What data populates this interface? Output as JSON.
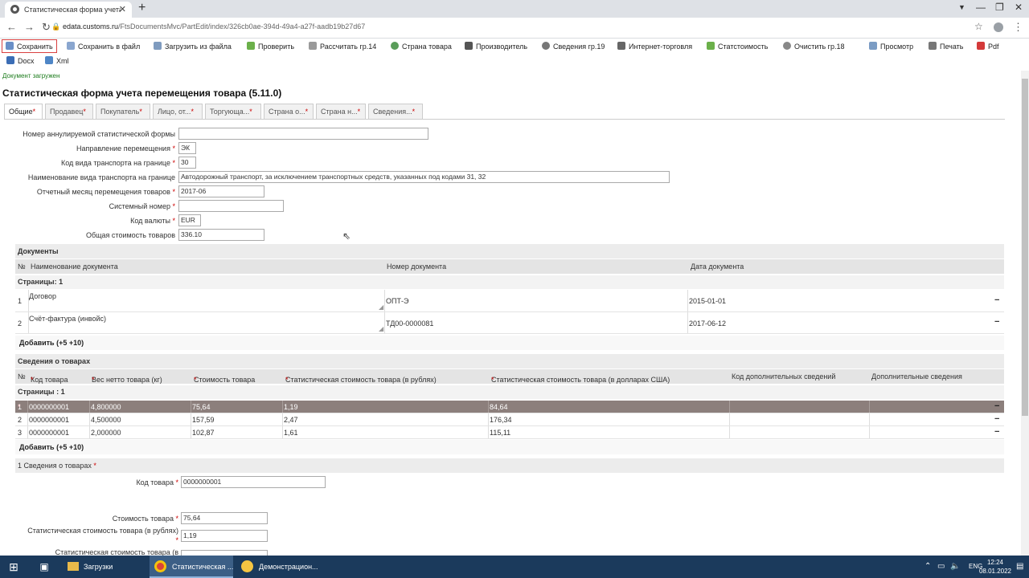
{
  "browser": {
    "tab_title": "Статистическая форма учета п...",
    "tab_close": "✕",
    "new_tab": "+",
    "url_host": "edata.customs.ru",
    "url_path": "/FtsDocumentsMvc/PartEdit/index/326cb0ae-394d-49a4-a27f-aadb19b27d67"
  },
  "toolbar": {
    "save": "Сохранить",
    "save_file": "Сохранить в файл",
    "load_file": "Загрузить из файла",
    "check": "Проверить",
    "calc": "Рассчитать гр.14",
    "country": "Страна товара",
    "producer": "Производитель",
    "info19": "Сведения гр.19",
    "internet": "Интернет-торговля",
    "statcost": "Статстоимость",
    "clear18": "Очистить гр.18",
    "preview": "Просмотр",
    "print": "Печать",
    "pdf": "Pdf",
    "docx": "Docx",
    "xml": "Xml"
  },
  "status": "Документ загружен",
  "page_title": "Статистическая форма учета перемещения товара (5.11.0)",
  "tabs": [
    {
      "label": "Общие"
    },
    {
      "label": "Продавец"
    },
    {
      "label": "Покупатель"
    },
    {
      "label": "Лицо, от..."
    },
    {
      "label": "Торгующа..."
    },
    {
      "label": "Страна о..."
    },
    {
      "label": "Страна н..."
    },
    {
      "label": "Сведения..."
    }
  ],
  "required_mark": "*",
  "form": {
    "annul_label": "Номер аннулируемой статистической формы",
    "annul_value": "",
    "direction_label": "Направление перемещения",
    "direction_value": "ЭК",
    "transport_code_label": "Код вида транспорта на границе",
    "transport_code_value": "30",
    "transport_name_label": "Наименование вида транспорта на границе",
    "transport_name_value": "Автодорожный транспорт, за исключением транспортных средств, указанных под кодами 31, 32",
    "month_label": "Отчетный месяц перемещения товаров",
    "month_value": "2017-06",
    "sysnum_label": "Системный номер",
    "sysnum_value": "",
    "currency_label": "Код валюты",
    "currency_value": "EUR",
    "total_label": "Общая стоимость товаров",
    "total_value": "336.10"
  },
  "documents": {
    "title": "Документы",
    "columns": [
      "№",
      "Наименование документа",
      "Номер документа",
      "Дата документа"
    ],
    "pages": "Страницы: 1",
    "rows": [
      {
        "n": "1",
        "name": "Договор",
        "number": "ОПТ-Э",
        "date": "2015-01-01"
      },
      {
        "n": "2",
        "name": "Счёт-фактура (инвойс)",
        "number": "ТД00-0000081",
        "date": "2017-06-12"
      }
    ],
    "add": "Добавить  (+5  +10)"
  },
  "goods": {
    "title": "Сведения о товарах",
    "columns": [
      "№",
      "Код товара",
      "Вес нетто товара (кг)",
      "Стоимость товара",
      "Статистическая стоимость товара (в рублях)",
      "Статистическая стоимость товара (в долларах США)",
      "Код дополнительных сведений",
      "Дополнительные сведения"
    ],
    "pages": "Страницы : 1",
    "rows": [
      {
        "n": "1",
        "code": "0000000001",
        "weight": "4,800000",
        "cost": "75,64",
        "stat_rub": "1,19",
        "stat_usd": "84,64"
      },
      {
        "n": "2",
        "code": "0000000001",
        "weight": "4,500000",
        "cost": "157,59",
        "stat_rub": "2,47",
        "stat_usd": "176,34"
      },
      {
        "n": "3",
        "code": "0000000001",
        "weight": "2,000000",
        "cost": "102,87",
        "stat_rub": "1,61",
        "stat_usd": "115,11"
      }
    ],
    "minus": "−",
    "add": "Добавить  (+5  +10)"
  },
  "detail": {
    "title": "1 Сведения о товарах",
    "code_label": "Код товара",
    "code_value": "0000000001",
    "cost_label": "Стоимость товара",
    "cost_value": "75,64",
    "stat_rub_label": "Статистическая стоимость товара (в рублях)",
    "stat_rub_value": "1,19",
    "stat_usd_label": "Статистическая стоимость товара (в"
  },
  "taskbar": {
    "item1": "Загрузки",
    "item2": "Статистическая ...",
    "item3": "Демонстрацион...",
    "lang": "ENG",
    "time": "12:24",
    "date": "08.01.2022"
  },
  "colors": {
    "selected_row": "#8c7f7c",
    "required": "#cc0000",
    "status_text": "#1c7c1c",
    "taskbar": "#1b3a5c"
  }
}
